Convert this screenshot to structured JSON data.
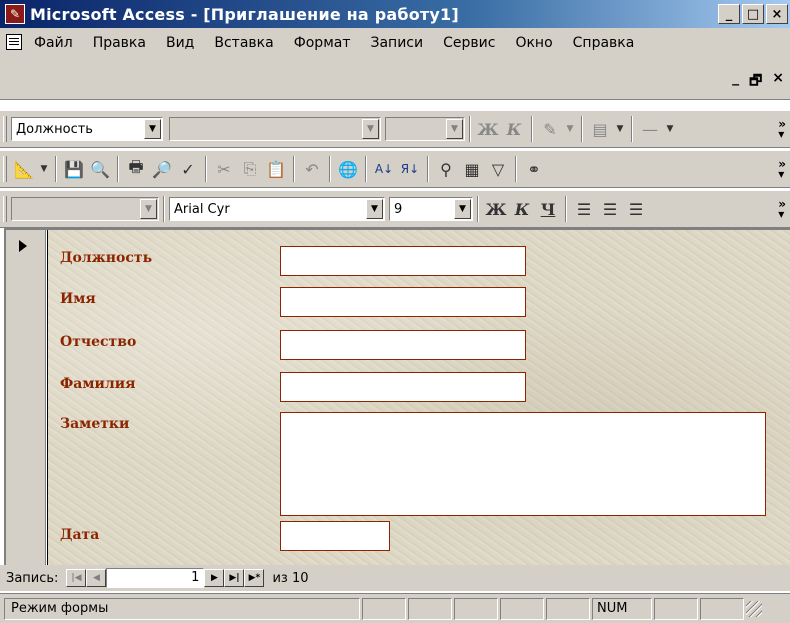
{
  "window": {
    "title": "Microsoft Access - [Приглашение на работу1]",
    "minimize": "_",
    "restore": "□",
    "close": "×",
    "mdi_minimize": "_",
    "mdi_restore": "🗗",
    "mdi_close": "×"
  },
  "menu": {
    "items": [
      "Файл",
      "Правка",
      "Вид",
      "Вставка",
      "Формат",
      "Записи",
      "Сервис",
      "Окно",
      "Справка"
    ]
  },
  "toolbar1": {
    "object_combo": "Должность",
    "font_combo_placeholder": "",
    "size_combo_placeholder": "",
    "bold": "Ж",
    "italic": "К"
  },
  "toolbar3": {
    "font_name": "Arial Cyr",
    "font_size": "9",
    "bold": "Ж",
    "italic": "К",
    "underline": "Ч"
  },
  "form": {
    "fields": [
      {
        "label": "Должность",
        "value": ""
      },
      {
        "label": "Имя",
        "value": ""
      },
      {
        "label": "Отчество",
        "value": ""
      },
      {
        "label": "Фамилия",
        "value": ""
      },
      {
        "label": "Заметки",
        "value": ""
      },
      {
        "label": "Дата",
        "value": ""
      }
    ]
  },
  "navigation": {
    "label": "Запись:",
    "current": "1",
    "of_label": "из 10"
  },
  "status": {
    "mode": "Режим формы",
    "num": "NUM"
  },
  "colors": {
    "title_bar": "#0a246a",
    "face": "#d4d0c8",
    "label": "#8b2500",
    "field_border": "#8b2500"
  }
}
